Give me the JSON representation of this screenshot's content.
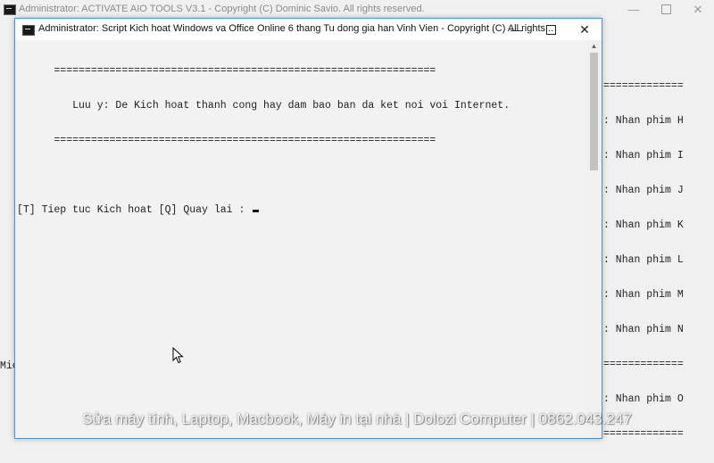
{
  "background_window": {
    "title": "Administrator:  ACTIVATE AIO TOOLS V3.1 - Copyright (C) Dominic Savio. All rights reserved.",
    "controls": {
      "minimize": "—",
      "close": "✕"
    },
    "console_lines": [
      "=============",
      ": Nhan phim H",
      ": Nhan phim I",
      ": Nhan phim J",
      ": Nhan phim K",
      ": Nhan phim L",
      ": Nhan phim M",
      ": Nhan phim N",
      "=============",
      ": Nhan phim O",
      "============="
    ],
    "left_fragment": "Mic"
  },
  "foreground_window": {
    "title": "Administrator:  Script Kich hoat Windows va Office Online 6 thang Tu dong gia han Vinh Vien - Copyright (C) All rights...",
    "controls": {
      "minimize": "—",
      "close": "✕"
    },
    "console_lines": [
      "      ==============================================================",
      "         Luu y: De Kich hoat thanh cong hay dam bao ban da ket noi voi Internet.",
      "      ==============================================================",
      "",
      "[T] Tiep tuc Kich hoat [Q] Quay lai : "
    ]
  },
  "icons": {
    "console": "console-icon",
    "pointer": "mouse-pointer-icon",
    "scroll_up": "scroll-up-arrow-icon"
  },
  "watermark": "Sửa máy tính, Laptop, Macbook, Máy in tại nhà | Dolozi Computer | 0862.043.247",
  "colors": {
    "accent_border": "#4a90d9",
    "console_bg": "#f2f2f2",
    "text": "#1e1e1e"
  }
}
